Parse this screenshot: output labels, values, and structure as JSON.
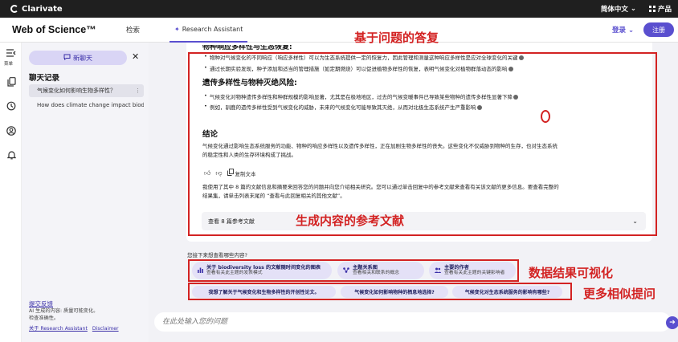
{
  "topbar": {
    "brand": "Clarivate",
    "lang": "简体中文",
    "lang_chevron": "⌄",
    "products": "产品",
    "colors": {
      "bg": "#1f1f1f"
    }
  },
  "header": {
    "logo": "Web of Science™",
    "nav_search": "检索",
    "nav_assistant": "Research Assistant",
    "login": "登录",
    "login_chevron": "⌄",
    "register": "注册",
    "accent": "#5a4fcf"
  },
  "rail": {
    "toggle_label": "菜单",
    "icons": [
      "sidebar-toggle-icon",
      "copy-icon",
      "history-icon",
      "user-icon",
      "bell-icon"
    ]
  },
  "sidebar": {
    "new_chat": "新聊天",
    "history_title": "聊天记录",
    "history": [
      {
        "label": "气候变化如何影响生物多样性？",
        "more": "⋮"
      },
      {
        "label": "How does climate change impact biodiversity?"
      }
    ],
    "feedback": "提交反馈",
    "ai_note_1": "AI 生成的内容: 质量可能变化。",
    "ai_note_2": "检查准确性。",
    "about_link": "关于 Research Assistant",
    "disclaimer_link": "Disclaimer"
  },
  "answer": {
    "cut_heading": "物种响应多样性与生态恢复:",
    "section1_bullets": [
      "物种对气候变化的不同响应（响应多样性）可以为生态系统提供一定的恢复力，因此管理和测量这种响应多样性是应对全球变化的关键",
      "通过长期实验发现，种子添加和适当的管理措施（如定期燃烧）可以促进植物多样性的恢复，表明气候变化对植物群落动态的影响"
    ],
    "section2_title": "遗传多样性与物种灭绝风险:",
    "section2_bullets": [
      "气候变化对物种遗传多样性和种群规模的影响显著，尤其是在极地地区，过去的气候变暖事件已导致某些物种的遗传多样性显著下降",
      "例如，驯鹿的遗传多样性受到气候变化的威胁，未来的气候变化可能导致其灭绝，从而对北极生态系统产生严重影响"
    ],
    "conclusion_title": "结论",
    "conclusion_lines": [
      "气候变化通过影响生态系统服务的功能、物种的响应多样性以及遗传多样性，正在加剧生物多样性的丧失。这些变化不仅威胁到物种的生存，也对生态系统",
      "的稳定性和人类的生存环境构成了挑战。"
    ],
    "copy_text": "复制文本",
    "source_lines": [
      "我使用了其中 8 篇的文献信息和摘要来回答您的问题并向您介绍相关研究。您可以通过单击回复中的参考文献来查看有关该文献的更多信息。要查看完整的",
      "结果集，请单击列表末尾的 “查看与此回复相关的其他文献”。"
    ],
    "refs_label": "查看 8 篇参考文献",
    "refs_chevron": "⌄"
  },
  "annotations": {
    "answer": "基于问题的答复",
    "refs": "生成内容的参考文献",
    "viz": "数据结果可视化",
    "similar": "更多相似提问",
    "color": "#d32323"
  },
  "explore": {
    "label": "您接下来想查看哪些内容?",
    "chips": [
      {
        "title": "关于 biodiversity loss 的文献随时间变化的图表",
        "sub": "查看有关此主题的发表模式",
        "icon": "bar-chart-icon"
      },
      {
        "title": "主题关系图",
        "sub": "查看相关和联系的概念",
        "icon": "network-icon"
      },
      {
        "title": "主要的作者",
        "sub": "查看有关此主题的关键影响者",
        "icon": "people-icon"
      }
    ],
    "questions": [
      "我想了解关于气候变化和生物多样性的开创性论文。",
      "气候变化如何影响物种的栖息地选择?",
      "气候变化对生态系统服务的影响有哪些?"
    ]
  },
  "input": {
    "placeholder": "在此处输入您的问题",
    "send_icon": "send-arrow-icon"
  }
}
